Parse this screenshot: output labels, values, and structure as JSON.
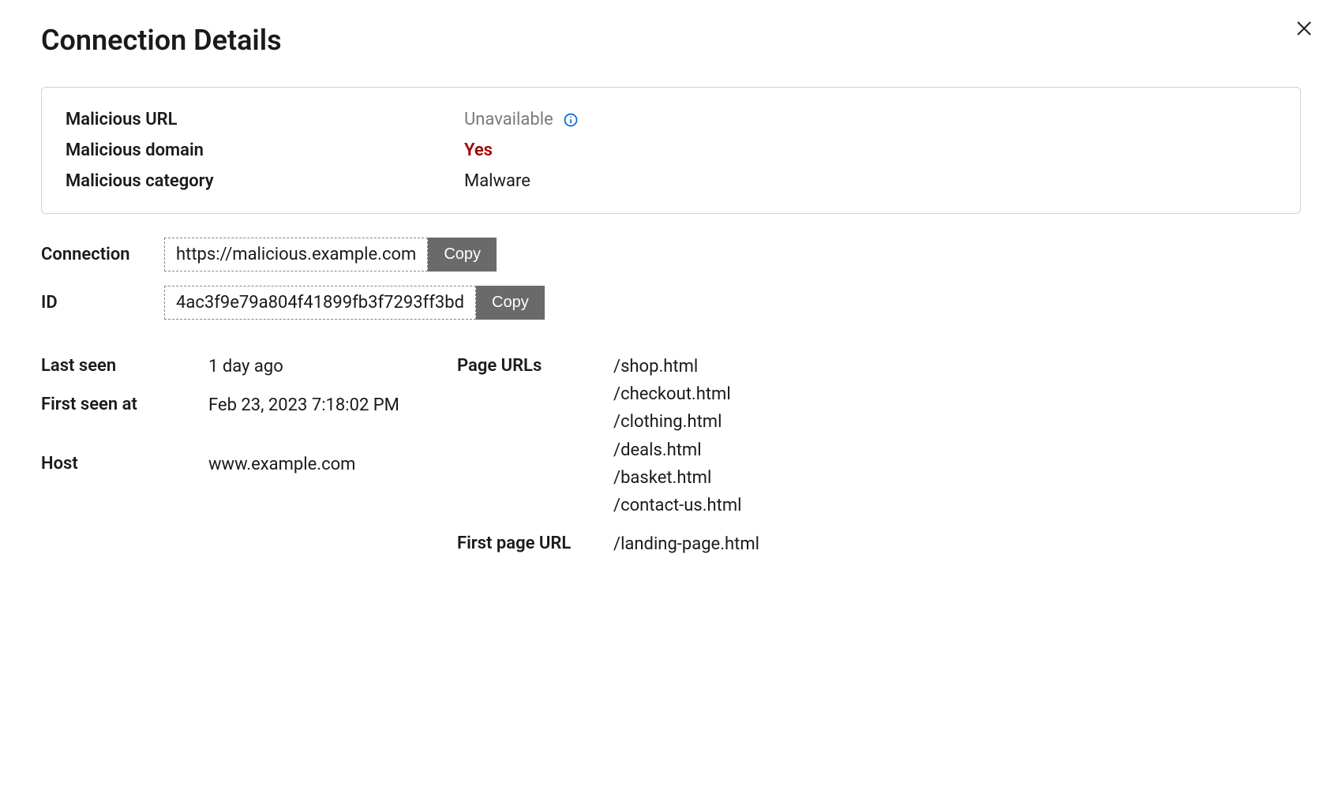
{
  "title": "Connection Details",
  "panel": {
    "maliciousUrl": {
      "label": "Malicious URL",
      "value": "Unavailable"
    },
    "maliciousDomain": {
      "label": "Malicious domain",
      "value": "Yes"
    },
    "maliciousCategory": {
      "label": "Malicious category",
      "value": "Malware"
    }
  },
  "connection": {
    "label": "Connection",
    "value": "https://malicious.example.com",
    "copyLabel": "Copy"
  },
  "id": {
    "label": "ID",
    "value": "4ac3f9e79a804f41899fb3f7293ff3bd",
    "copyLabel": "Copy"
  },
  "lastSeen": {
    "label": "Last seen",
    "value": "1 day ago"
  },
  "firstSeenAt": {
    "label": "First seen at",
    "value": "Feb 23, 2023 7:18:02 PM"
  },
  "host": {
    "label": "Host",
    "value": "www.example.com"
  },
  "pageUrls": {
    "label": "Page URLs",
    "items": [
      "/shop.html",
      "/checkout.html",
      "/clothing.html",
      "/deals.html",
      "/basket.html",
      "/contact-us.html"
    ]
  },
  "firstPageUrl": {
    "label": "First page URL",
    "value": "/landing-page.html"
  }
}
